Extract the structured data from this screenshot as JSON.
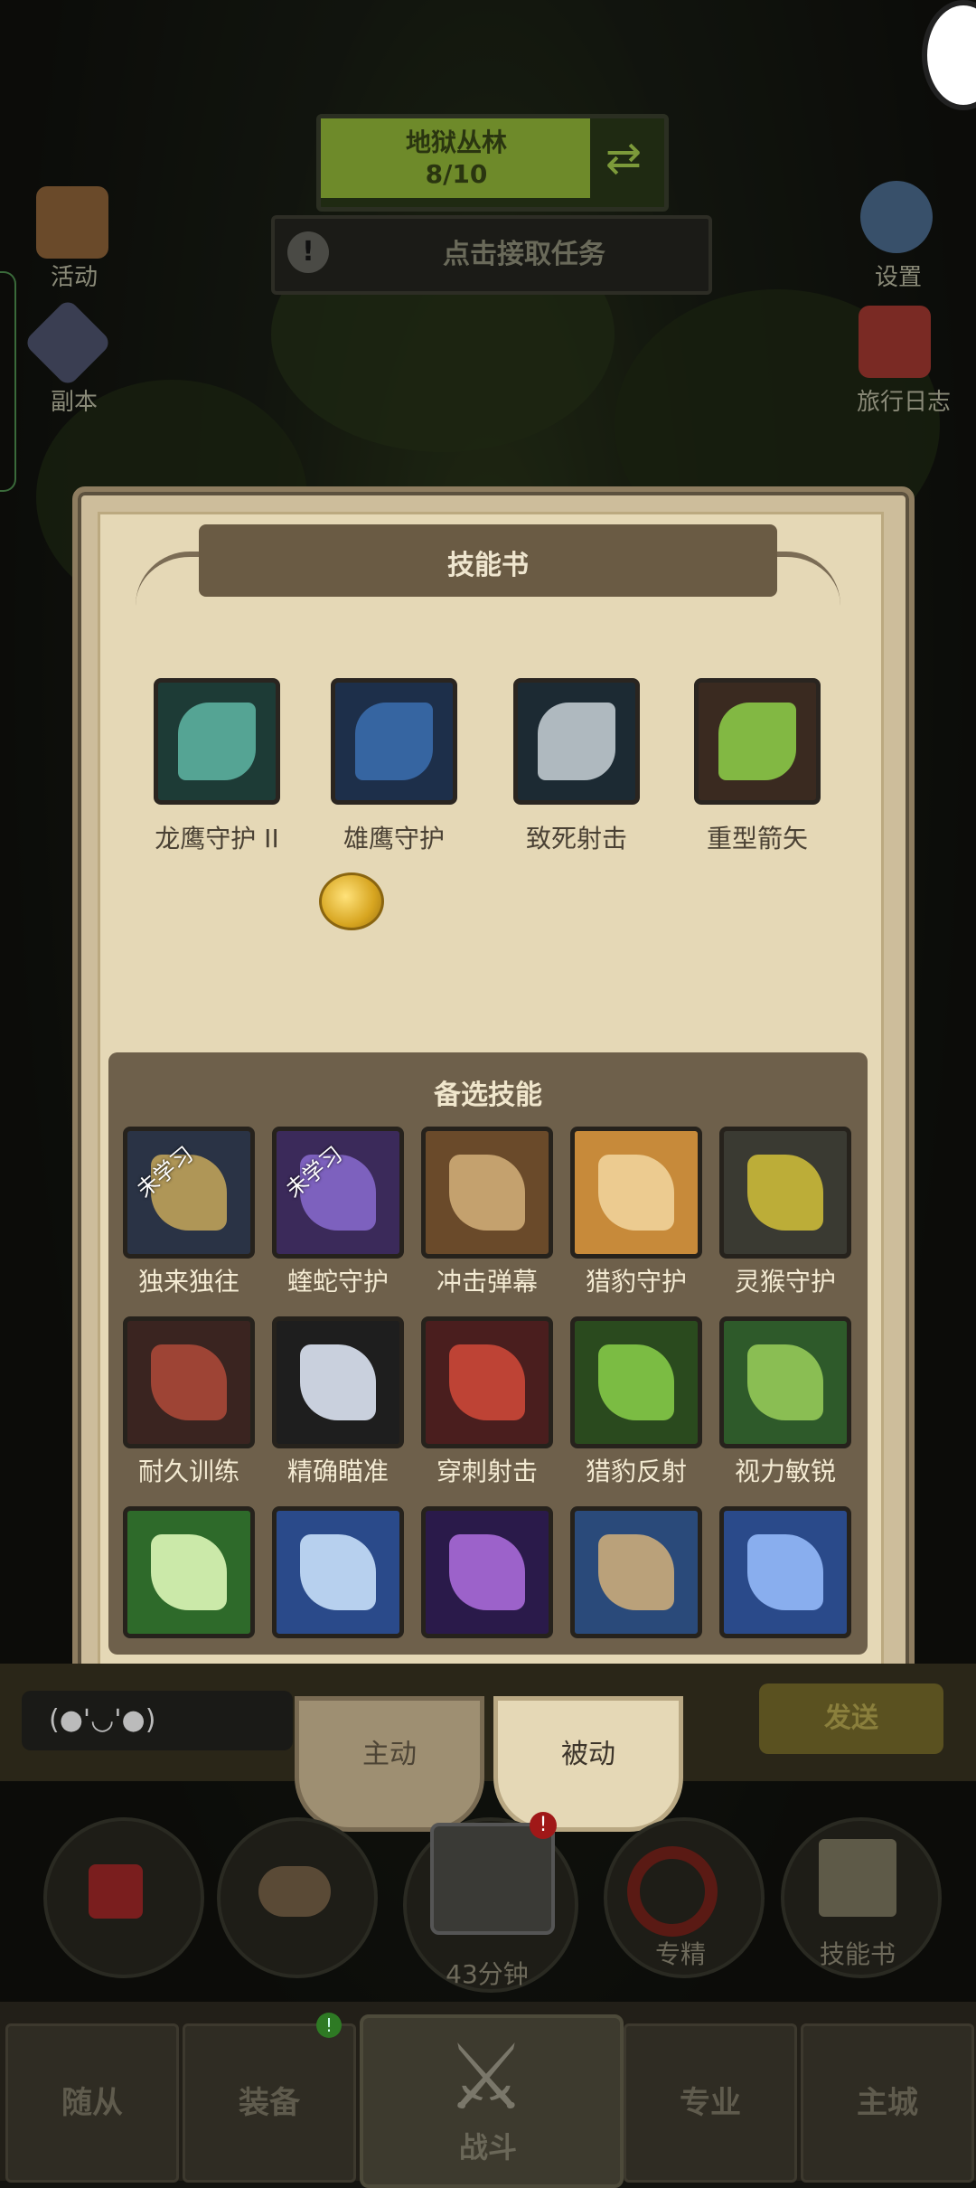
{
  "top": {
    "zone_title": "地狱丛林",
    "zone_progress": "8/10",
    "task_label": "点击接取任务",
    "task_icon": "!"
  },
  "side_left": [
    {
      "label": "活动",
      "icon": "scroll-icon"
    },
    {
      "label": "副本",
      "icon": "portal-icon"
    }
  ],
  "side_right": [
    {
      "label": "设置",
      "icon": "gear-icon"
    },
    {
      "label": "旅行日志",
      "icon": "book-icon"
    }
  ],
  "dialog": {
    "title": "技能书",
    "equipped": [
      {
        "label": "龙鹰守护 II",
        "icon": "dragonhawk-icon",
        "bg": "#1d3b36",
        "fg": "#5fb7a4"
      },
      {
        "label": "雄鹰守护",
        "icon": "eagle-swirl-icon",
        "bg": "#1d2f4a",
        "fg": "#3b6fb0"
      },
      {
        "label": "致死射击",
        "icon": "arrow-icon",
        "bg": "#1c2a33",
        "fg": "#c9d2d8"
      },
      {
        "label": "重型箭矢",
        "icon": "heavy-arrow-icon",
        "bg": "#3a2a20",
        "fg": "#8fd14a"
      }
    ],
    "alt_title": "备选技能",
    "unlearned_tag": "未学习",
    "skills": [
      {
        "label": "独来独往",
        "icon": "spear-icon",
        "bg": "#2a3345",
        "fg": "#c7a85a",
        "unlearned": true
      },
      {
        "label": "蝰蛇守护",
        "icon": "viper-eye-icon",
        "bg": "#3b2a5a",
        "fg": "#8a6bd0",
        "unlearned": true
      },
      {
        "label": "冲击弹幕",
        "icon": "blade-icon",
        "bg": "#6a4a2a",
        "fg": "#d4b07a",
        "unlearned": false
      },
      {
        "label": "猎豹守护",
        "icon": "cheetah-icon",
        "bg": "#c78a3a",
        "fg": "#f2d6a0",
        "unlearned": false
      },
      {
        "label": "灵猴守护",
        "icon": "monkey-fist-icon",
        "bg": "#3a3a32",
        "fg": "#d4c23a",
        "unlearned": false
      },
      {
        "label": "耐久训练",
        "icon": "body-icon",
        "bg": "#3a2420",
        "fg": "#b04a3a",
        "unlearned": false
      },
      {
        "label": "精确瞄准",
        "icon": "crosshair-icon",
        "bg": "#1e1e1e",
        "fg": "#e8f0ff",
        "unlearned": false
      },
      {
        "label": "穿刺射击",
        "icon": "pierce-arrow-icon",
        "bg": "#4a1e1e",
        "fg": "#d24a3a",
        "unlearned": false
      },
      {
        "label": "猎豹反射",
        "icon": "streak-icon",
        "bg": "#2a4a1e",
        "fg": "#8ad04a",
        "unlearned": false
      },
      {
        "label": "视力敏锐",
        "icon": "eagle-head-icon",
        "bg": "#2e5a2a",
        "fg": "#9ad05a",
        "unlearned": false
      },
      {
        "label": "",
        "icon": "phoenix-icon",
        "bg": "#2e6a2a",
        "fg": "#e6ffc0",
        "unlearned": false
      },
      {
        "label": "",
        "icon": "archer-icon",
        "bg": "#2a4a8a",
        "fg": "#d0e8ff",
        "unlearned": false
      },
      {
        "label": "",
        "icon": "purple-arrow-icon",
        "bg": "#2a1a4a",
        "fg": "#b070e0",
        "unlearned": false
      },
      {
        "label": "",
        "icon": "griffin-icon",
        "bg": "#2a4a7a",
        "fg": "#d4b07a",
        "unlearned": false
      },
      {
        "label": "",
        "icon": "hunter-icon",
        "bg": "#2a4a8a",
        "fg": "#9ac0ff",
        "unlearned": false
      }
    ]
  },
  "chat": {
    "emote": "(●'◡'●)",
    "send": "发送"
  },
  "tabs": {
    "active_label": "主动",
    "passive_label": "被动"
  },
  "actions": [
    {
      "label": "",
      "icon": "potion-icon"
    },
    {
      "label": "",
      "icon": "bread-icon"
    },
    {
      "label": "43分钟",
      "icon": "chest-icon"
    },
    {
      "label": "专精",
      "icon": "target-icon"
    },
    {
      "label": "技能书",
      "icon": "skillbook-icon"
    }
  ],
  "nav": {
    "left1": "随从",
    "left2": "装备",
    "center": "战斗",
    "right1": "专业",
    "right2": "主城"
  }
}
